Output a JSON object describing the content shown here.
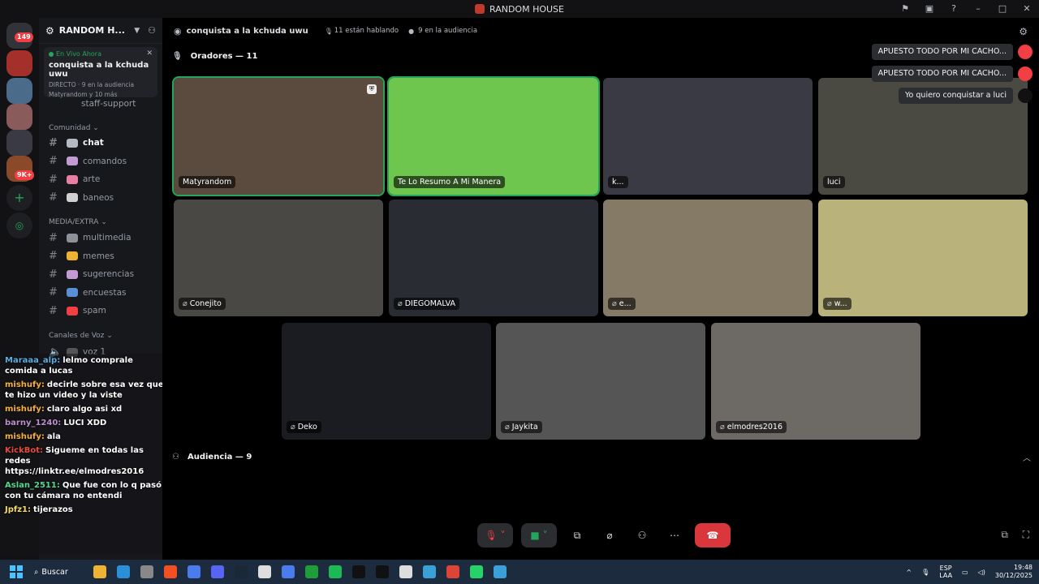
{
  "titlebar": {
    "title": "RANDOM HOUSE"
  },
  "rail": {
    "badges": [
      "149",
      "9K+"
    ]
  },
  "sidebar": {
    "server_name": "RANDOM H...",
    "live": {
      "status": "En Vivo Ahora",
      "title": "conquista a la kchuda uwu",
      "meta": "DIRECTO · 9 en la audiencia",
      "users": "Matyrandom y 10 más"
    },
    "partial_channel": "staff-support",
    "categories": [
      "Comunidad",
      "MEDIA/EXTRA",
      "Canales de Voz"
    ],
    "channels_comunidad": [
      {
        "label": "chat",
        "color": "#b5bac1"
      },
      {
        "label": "comandos",
        "color": "#c39bd3"
      },
      {
        "label": "arte",
        "color": "#e97fa0"
      },
      {
        "label": "baneos",
        "color": "#d0d0d0"
      }
    ],
    "channels_media": [
      {
        "label": "multimedia",
        "color": "#8f9199"
      },
      {
        "label": "memes",
        "color": "#f0b232"
      },
      {
        "label": "sugerencias",
        "color": "#c39bd3"
      },
      {
        "label": "encuestas",
        "color": "#5a8fd8"
      },
      {
        "label": "spam",
        "color": "#f23f43"
      }
    ],
    "voice_channel": "voz 1"
  },
  "chat": [
    {
      "user": "Maraaa_alp:",
      "text": "lelmo comprale comida a lucas",
      "color": "#5dade2"
    },
    {
      "user": "mishufy:",
      "text": "decirle sobre esa vez que te hizo un video y la viste",
      "color": "#f5b041"
    },
    {
      "user": "mishufy:",
      "text": "claro algo asi xd",
      "color": "#f5b041"
    },
    {
      "user": "barny_1240:",
      "text": "LUCI XDD",
      "color": "#bb8fce"
    },
    {
      "user": "mishufy:",
      "text": "ala",
      "color": "#f5b041"
    },
    {
      "user": "KickBot:",
      "text": "Siguеme en todas las redes https://linktr.ee/elmodres2016",
      "color": "#e74c3c"
    },
    {
      "user": "Aslan_2511:",
      "text": "Que fue con lo q pasó con tu cámara no entendi",
      "color": "#58d68d"
    },
    {
      "user": "Jpfz1:",
      "text": "tijerazos",
      "color": "#f7dc6f"
    }
  ],
  "main": {
    "channel": "conquista a la kchuda uwu",
    "talking": "11 están hablando",
    "audience": "9 en la audiencia",
    "speakers_label": "Oradores — 11",
    "audience_label": "Audiencia — 9"
  },
  "tiles": [
    {
      "name": "Matyrandom",
      "muted": false,
      "bg": "#5b4a3e",
      "speaking": true
    },
    {
      "name": "Te Lo Resumo A Mi Manera",
      "muted": false,
      "bg": "#6ec64f",
      "speaking": true
    },
    {
      "name": "k...",
      "muted": false,
      "bg": "#3a3a44",
      "speaking": false
    },
    {
      "name": "luci",
      "muted": false,
      "bg": "#4b4a42",
      "speaking": false
    },
    {
      "name": "Conejito",
      "muted": true,
      "bg": "#4a4844",
      "speaking": false
    },
    {
      "name": "DIEGOMALVA",
      "muted": true,
      "bg": "#2a2c33",
      "speaking": false
    },
    {
      "name": "e...",
      "muted": true,
      "bg": "#847a66",
      "speaking": false
    },
    {
      "name": "w...",
      "muted": true,
      "bg": "#b9b27a",
      "speaking": false
    },
    {
      "name": "Deko",
      "muted": true,
      "bg": "#1b1b22",
      "speaking": false
    },
    {
      "name": "Jaykita",
      "muted": true,
      "bg": "#555555",
      "speaking": false
    },
    {
      "name": "elmodres2016",
      "muted": true,
      "bg": "#6d6a66",
      "speaking": false
    }
  ],
  "toasts": [
    "APUESTO TODO POR MI CACHO...",
    "APUESTO TODO POR MI CACHO...",
    "Yo quiero conquistar a luci"
  ],
  "taskbar": {
    "search": "Buscar",
    "lang_top": "ESP",
    "lang_bottom": "LAA",
    "time": "19:48",
    "date": "30/12/2025",
    "apps": [
      "#f0b232",
      "#2b8fd8",
      "#888",
      "#f25022",
      "#4b7bec",
      "#5865f2",
      "#1b2838",
      "#ddd",
      "#4b7bec",
      "#1f9d3a",
      "#1db954",
      "#111",
      "#111",
      "#ddd",
      "#3ca0d8",
      "#db4437",
      "#25d366",
      "#3ca0d8"
    ]
  }
}
